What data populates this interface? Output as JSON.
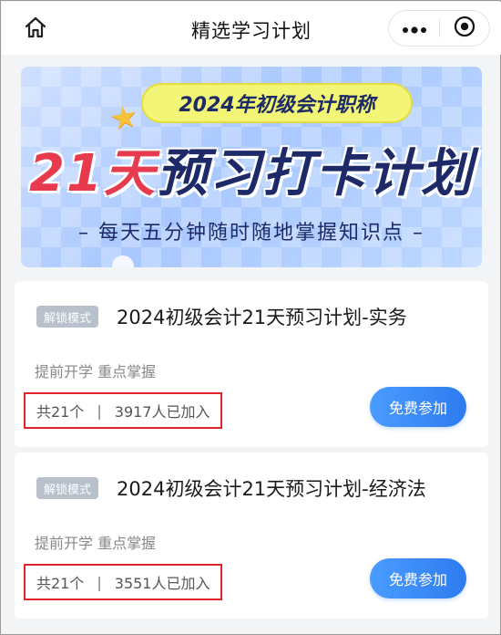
{
  "header": {
    "title": "精选学习计划",
    "icons": {
      "home": "home-icon",
      "more": "more-dots-icon",
      "close": "target-circle-icon"
    }
  },
  "banner": {
    "pill_text": "2024年初级会计职称",
    "headline_accent": "21天",
    "headline_rest": "预习打卡计划",
    "subline": "– 每天五分钟随时随地掌握知识点 –",
    "colors": {
      "accent": "#e83a4e",
      "navy": "#1e2a68",
      "pill": "#f3f577"
    }
  },
  "plans": [
    {
      "tag": "解锁模式",
      "title": "2024初级会计21天预习计划-实务",
      "subtitle": "提前开学 重点掌握",
      "count": "共21个",
      "separator": "|",
      "joined": "3917人已加入",
      "button": "免费参加"
    },
    {
      "tag": "解锁模式",
      "title": "2024初级会计21天预习计划-经济法",
      "subtitle": "提前开学 重点掌握",
      "count": "共21个",
      "separator": "|",
      "joined": "3551人已加入",
      "button": "免费参加"
    }
  ]
}
